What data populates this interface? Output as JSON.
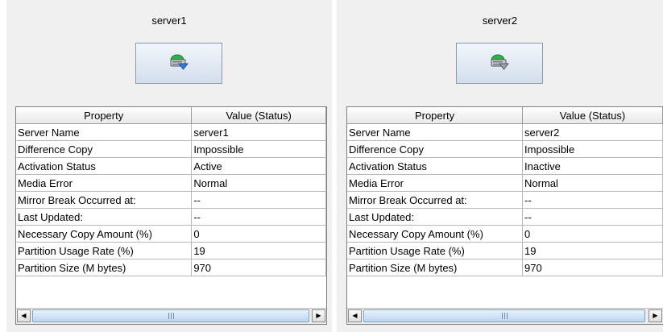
{
  "servers": [
    {
      "title": "server1",
      "icon": "server-icon",
      "columns": [
        "Property",
        "Value (Status)"
      ],
      "rows": [
        [
          "Server Name",
          "server1"
        ],
        [
          "Difference Copy",
          "Impossible"
        ],
        [
          "Activation Status",
          "Active"
        ],
        [
          "Media Error",
          "Normal"
        ],
        [
          "Mirror Break Occurred at:",
          "--"
        ],
        [
          "Last Updated:",
          "--"
        ],
        [
          "Necessary Copy Amount (%)",
          "0"
        ],
        [
          "Partition Usage Rate (%)",
          "19"
        ],
        [
          "Partition Size (M bytes)",
          "970"
        ]
      ]
    },
    {
      "title": "server2",
      "icon": "server-icon",
      "columns": [
        "Property",
        "Value (Status)"
      ],
      "rows": [
        [
          "Server Name",
          "server2"
        ],
        [
          "Difference Copy",
          "Impossible"
        ],
        [
          "Activation Status",
          "Inactive"
        ],
        [
          "Media Error",
          "Normal"
        ],
        [
          "Mirror Break Occurred at:",
          "--"
        ],
        [
          "Last Updated:",
          "--"
        ],
        [
          "Necessary Copy Amount (%)",
          "0"
        ],
        [
          "Partition Usage Rate (%)",
          "19"
        ],
        [
          "Partition Size (M bytes)",
          "970"
        ]
      ]
    }
  ],
  "colors": {
    "icon_green": "#2bb24c",
    "icon_blue": "#2f7be0",
    "panel_bg": "#f0f0f0"
  }
}
